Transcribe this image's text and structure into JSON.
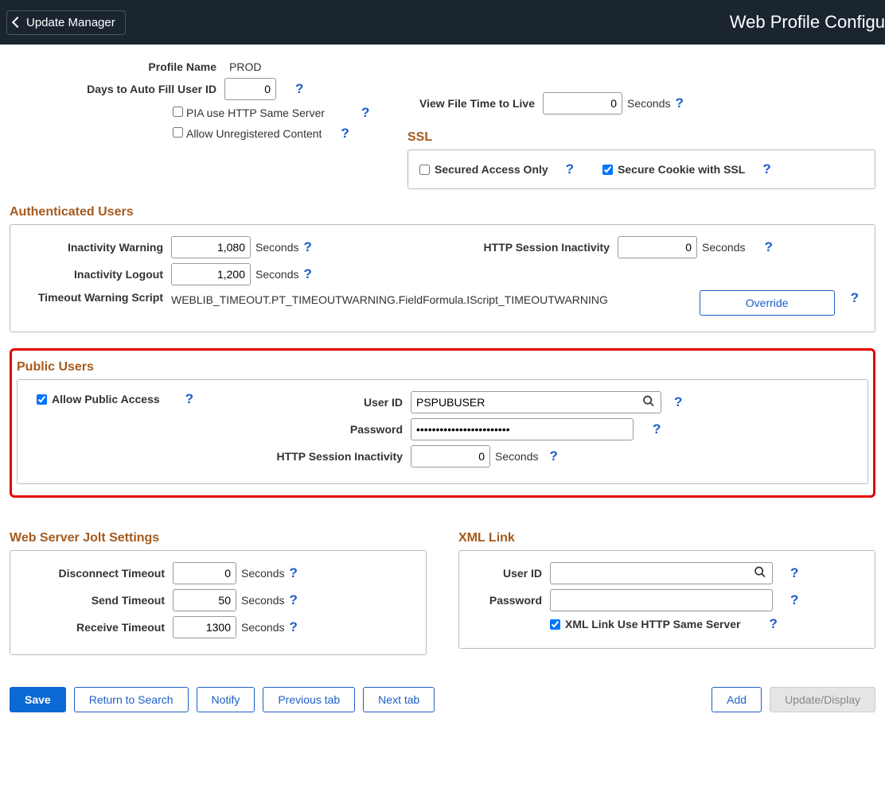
{
  "header": {
    "back_label": "Update Manager",
    "page_title": "Web Profile Configu"
  },
  "top": {
    "profile_name_label": "Profile Name",
    "profile_name_value": "PROD",
    "days_autofill_label": "Days to Auto Fill User ID",
    "days_autofill_value": "0",
    "pia_http_label": "PIA use HTTP Same Server",
    "pia_http_checked": false,
    "allow_unreg_label": "Allow Unregistered Content",
    "allow_unreg_checked": false,
    "view_file_ttl_label": "View File Time to Live",
    "view_file_ttl_value": "0",
    "seconds": "Seconds"
  },
  "ssl": {
    "title": "SSL",
    "secured_label": "Secured Access Only",
    "secured_checked": false,
    "secure_cookie_label": "Secure Cookie with SSL",
    "secure_cookie_checked": true
  },
  "auth": {
    "title": "Authenticated Users",
    "inact_warn_label": "Inactivity Warning",
    "inact_warn_value": "1,080",
    "inact_logout_label": "Inactivity Logout",
    "inact_logout_value": "1,200",
    "http_sess_label": "HTTP Session Inactivity",
    "http_sess_value": "0",
    "timeout_script_label": "Timeout Warning Script",
    "timeout_script_value": "WEBLIB_TIMEOUT.PT_TIMEOUTWARNING.FieldFormula.IScript_TIMEOUTWARNING",
    "override_label": "Override",
    "seconds": "Seconds"
  },
  "public": {
    "title": "Public Users",
    "allow_label": "Allow Public Access",
    "allow_checked": true,
    "userid_label": "User ID",
    "userid_value": "PSPUBUSER",
    "password_label": "Password",
    "password_value": "••••••••••••••••••••••••",
    "http_sess_label": "HTTP Session Inactivity",
    "http_sess_value": "0",
    "seconds": "Seconds"
  },
  "jolt": {
    "title": "Web Server Jolt Settings",
    "disconnect_label": "Disconnect Timeout",
    "disconnect_value": "0",
    "send_label": "Send Timeout",
    "send_value": "50",
    "receive_label": "Receive Timeout",
    "receive_value": "1300",
    "seconds": "Seconds"
  },
  "xml": {
    "title": "XML Link",
    "userid_label": "User ID",
    "userid_value": "",
    "password_label": "Password",
    "password_value": "",
    "http_same_label": "XML Link Use HTTP Same Server",
    "http_same_checked": true
  },
  "footer": {
    "save": "Save",
    "return_search": "Return to Search",
    "notify": "Notify",
    "prev_tab": "Previous tab",
    "next_tab": "Next tab",
    "add": "Add",
    "update_display": "Update/Display"
  }
}
